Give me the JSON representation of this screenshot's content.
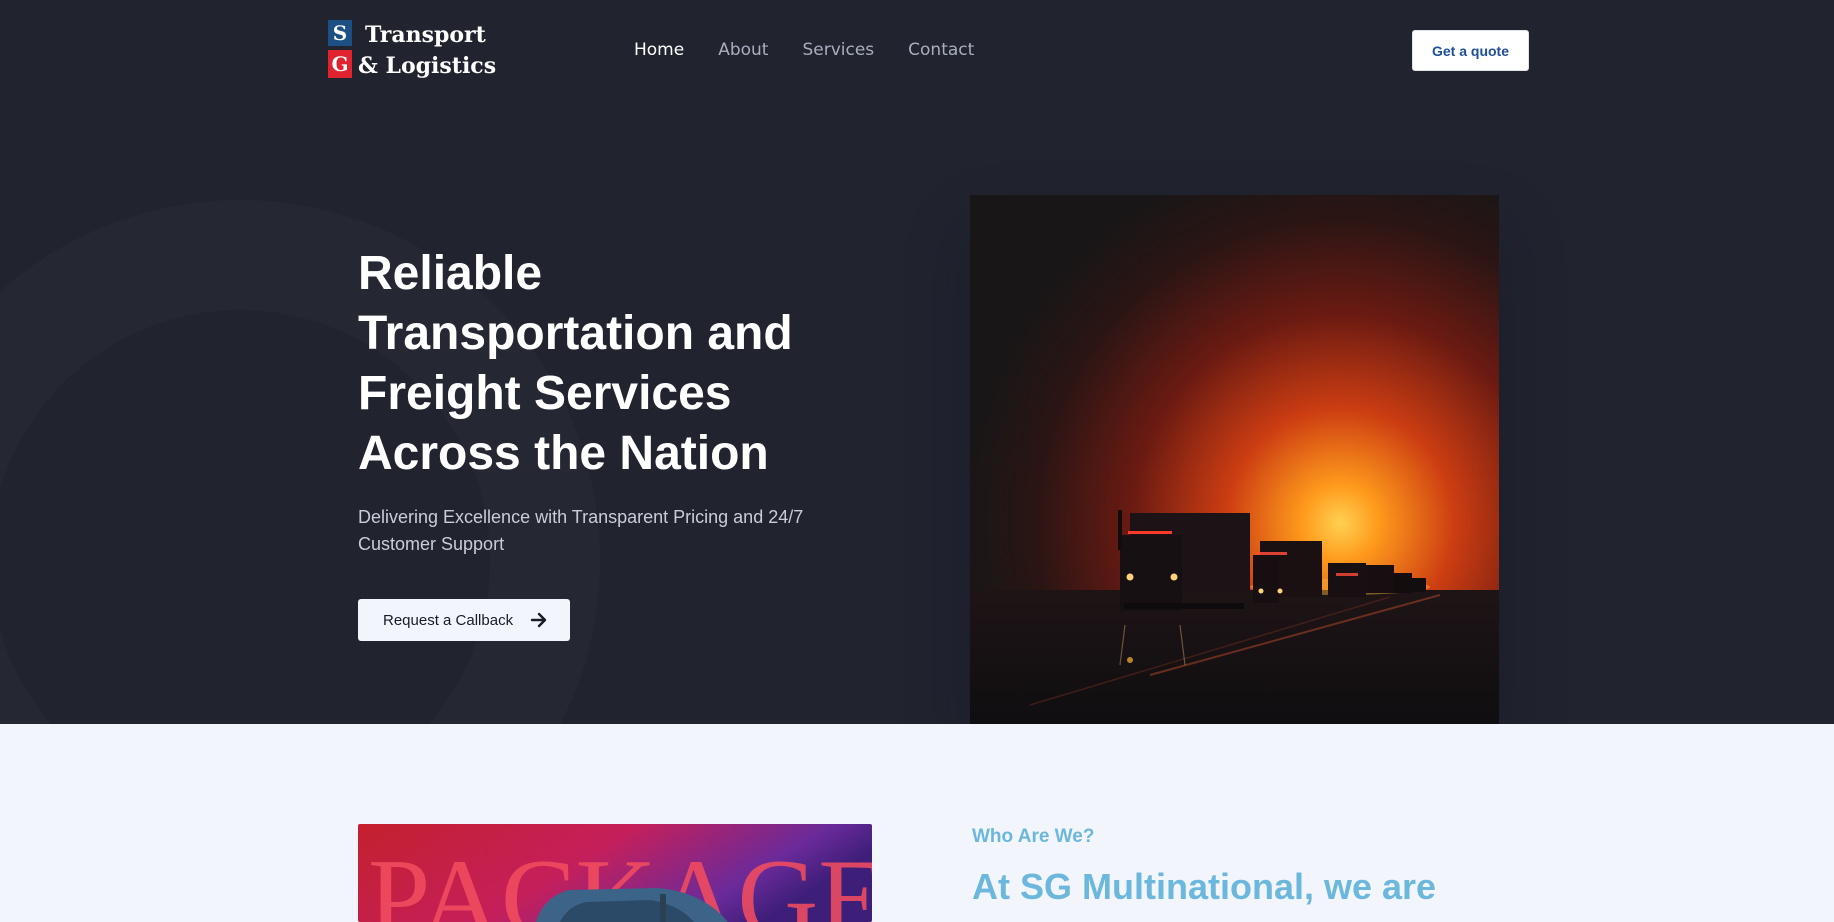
{
  "brand": {
    "line1": "Transport",
    "line2": "& Logistics",
    "mark_top": "S",
    "mark_bottom": "G"
  },
  "nav": {
    "items": [
      {
        "label": "Home",
        "active": true
      },
      {
        "label": "About",
        "active": false
      },
      {
        "label": "Services",
        "active": false
      },
      {
        "label": "Contact",
        "active": false
      }
    ],
    "quote_label": "Get a quote"
  },
  "hero": {
    "title_lines": [
      "Reliable",
      "Transportation and",
      "Freight Services",
      "Across the Nation"
    ],
    "subtitle": "Delivering Excellence with Transparent Pricing and 24/7 Customer Support",
    "cta_label": "Request a Callback",
    "cta_icon": "arrow-right-icon",
    "image": "trucks-on-highway-at-sunset"
  },
  "about": {
    "image_text": "PACKAGE",
    "label": "Who Are We?",
    "heading": "At SG Multinational, we are"
  },
  "colors": {
    "hero_bg": "#21242f",
    "page_bg": "#f2f5fc",
    "accent_blue": "#6cb7dc",
    "quote_text": "#1e4f97",
    "logo_blue": "#1c4f84",
    "logo_red": "#e1232e"
  }
}
